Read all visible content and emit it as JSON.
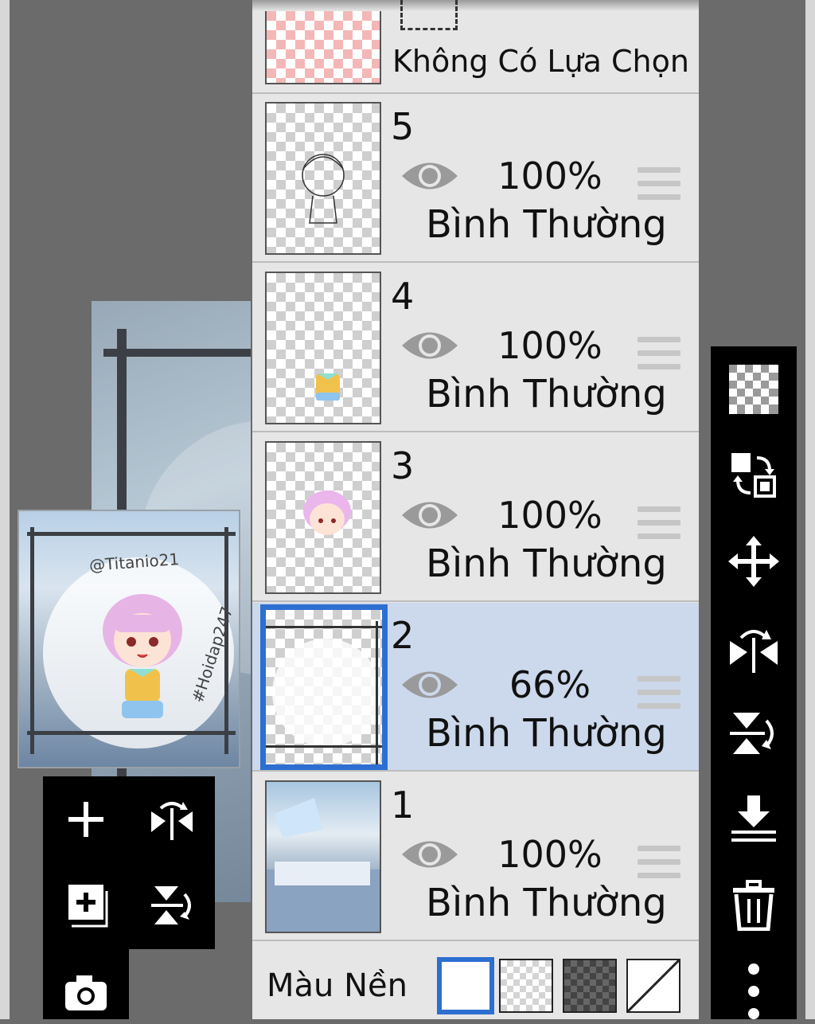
{
  "top_layer": {
    "selection_label": "Không Có Lựa Chọn"
  },
  "layers": [
    {
      "number": "5",
      "opacity": "100%",
      "blend_mode": "Bình Thường"
    },
    {
      "number": "4",
      "opacity": "100%",
      "blend_mode": "Bình Thường"
    },
    {
      "number": "3",
      "opacity": "100%",
      "blend_mode": "Bình Thường"
    },
    {
      "number": "2",
      "opacity": "66%",
      "blend_mode": "Bình Thường",
      "selected": true
    },
    {
      "number": "1",
      "opacity": "100%",
      "blend_mode": "Bình Thường"
    }
  ],
  "preview": {
    "watermark_top": "@Titanio21",
    "watermark_side": "#Hoidap247"
  },
  "background_color": {
    "label": "Màu Nền",
    "options": [
      "white",
      "transparent-checker",
      "dark-checker",
      "none"
    ],
    "selected": "white"
  },
  "tools_left": [
    "add-layer-icon",
    "flip-horizontal-icon",
    "add-layer-copy-icon",
    "flip-vertical-icon",
    "camera-icon"
  ],
  "tools_right": [
    "transparency-checker-icon",
    "swap-layers-icon",
    "move-icon",
    "flip-horizontal-icon",
    "flip-vertical-icon",
    "merge-down-icon",
    "trash-icon",
    "more-vertical-icon"
  ],
  "colors": {
    "accent": "#2d6fd1",
    "selected_row": "#ccd8ec",
    "panel": "#e6e6e6"
  }
}
